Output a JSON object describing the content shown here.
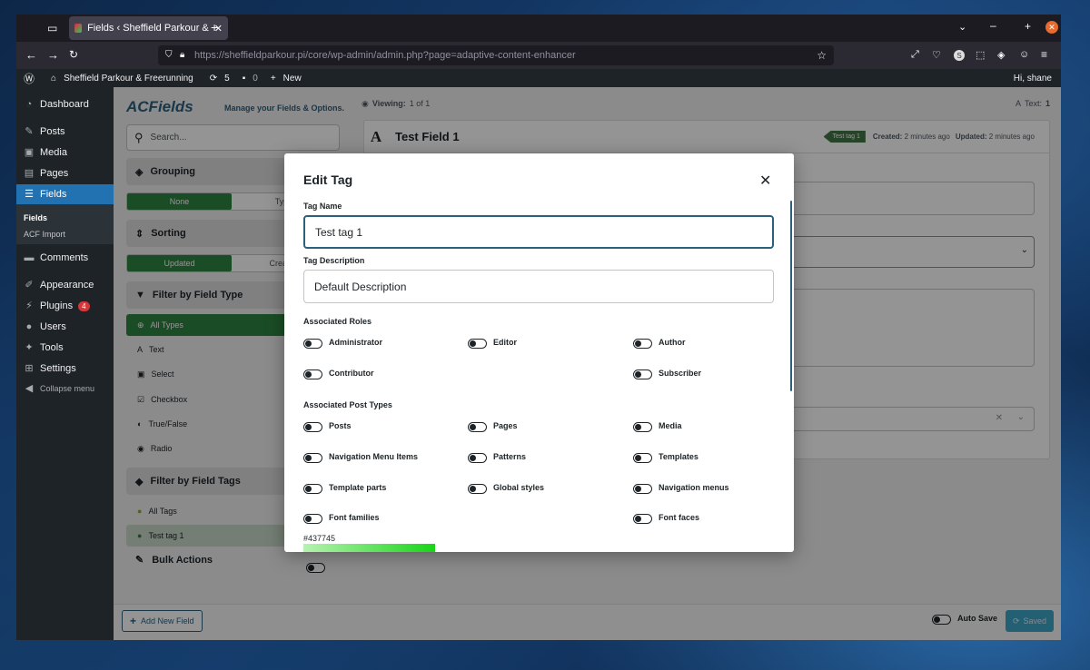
{
  "browser": {
    "tab_title": "Fields ‹ Sheffield Parkour &",
    "url_host": "https://sheffieldparkour.pi",
    "url_path": "/core/wp-admin/admin.php?page=adaptive-content-enhancer",
    "new_tab": "+"
  },
  "adminbar": {
    "site_name": "Sheffield Parkour & Freerunning",
    "updates": "5",
    "comments": "0",
    "new_label": "New",
    "greeting": "Hi, shane"
  },
  "sidebar": {
    "items": [
      {
        "label": "Dashboard",
        "icon": "dashboard-icon"
      },
      {
        "label": "Posts",
        "icon": "pin-icon"
      },
      {
        "label": "Media",
        "icon": "media-icon"
      },
      {
        "label": "Pages",
        "icon": "pages-icon"
      },
      {
        "label": "Fields",
        "icon": "fields-icon"
      },
      {
        "label": "Comments",
        "icon": "comment-icon"
      },
      {
        "label": "Appearance",
        "icon": "brush-icon"
      },
      {
        "label": "Plugins",
        "icon": "plug-icon",
        "badge": "4"
      },
      {
        "label": "Users",
        "icon": "user-icon"
      },
      {
        "label": "Tools",
        "icon": "wrench-icon"
      },
      {
        "label": "Settings",
        "icon": "settings-icon"
      },
      {
        "label": "Collapse menu",
        "icon": "collapse-icon"
      }
    ],
    "submenu": [
      "Fields",
      "ACF Import"
    ]
  },
  "plugin": {
    "logo": "ACFields",
    "tagline": "Manage your Fields & Options.",
    "search_placeholder": "Search...",
    "grouping_title": "Grouping",
    "grouping_options": [
      "None",
      "Type"
    ],
    "sorting_title": "Sorting",
    "sorting_options": [
      "Updated",
      "Created"
    ],
    "filter_type_title": "Filter by Field Type",
    "filter_types": [
      "All Types",
      "Text",
      "Select",
      "Checkbox",
      "True/False",
      "Radio"
    ],
    "filter_tags_title": "Filter by Field Tags",
    "filter_tags": [
      "All Tags",
      "Test tag 1"
    ],
    "bulk_actions": "Bulk Actions",
    "add_new_field": "Add New Field",
    "auto_save": "Auto Save",
    "saved": "Saved"
  },
  "viewer": {
    "viewing_label": "Viewing:",
    "viewing_value": "1 of 1",
    "text_count_label": "Text:",
    "text_count_value": "1",
    "field_title": "Test Field 1",
    "field_tag": "Test tag 1",
    "created_label": "Created:",
    "created_value": "2 minutes ago",
    "updated_label": "Updated:",
    "updated_value": "2 minutes ago"
  },
  "modal": {
    "title": "Edit Tag",
    "tag_name_label": "Tag Name",
    "tag_name_value": "Test tag 1",
    "tag_desc_label": "Tag Description",
    "tag_desc_value": "Default Description",
    "roles_label": "Associated Roles",
    "roles": [
      "Administrator",
      "Editor",
      "Author",
      "Contributor",
      "Subscriber"
    ],
    "post_types_label": "Associated Post Types",
    "post_types": [
      "Posts",
      "Pages",
      "Media",
      "Navigation Menu Items",
      "Patterns",
      "Templates",
      "Template parts",
      "Global styles",
      "Navigation menus",
      "Font families",
      "Font faces"
    ],
    "color_hex": "#437745"
  },
  "colors": {
    "wp_blue": "#2271b1",
    "green": "#2e8540",
    "admin_dark": "#1d2327",
    "tag_color": "#437745"
  }
}
